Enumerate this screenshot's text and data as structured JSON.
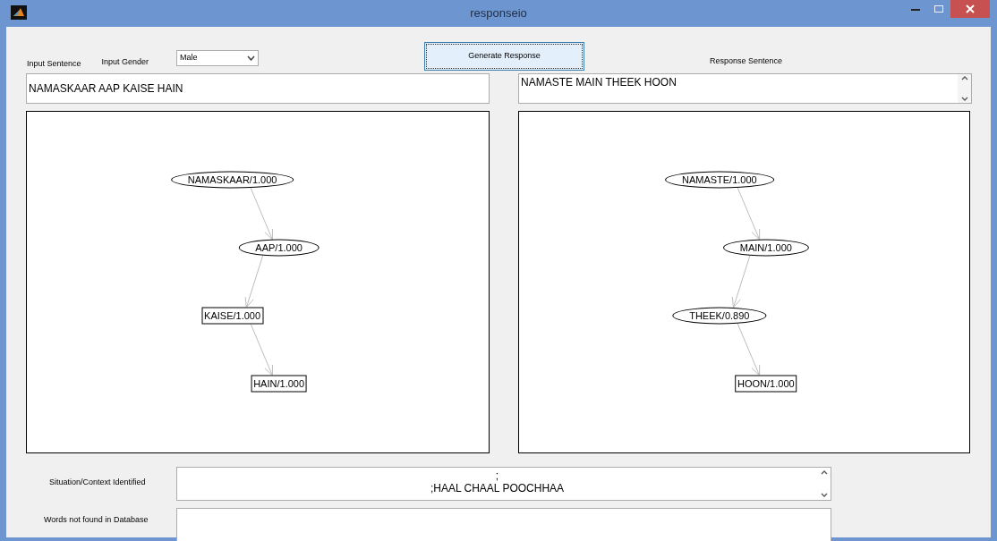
{
  "window": {
    "title": "responseio"
  },
  "input_sentence_label": "Input Sentence",
  "input_gender": {
    "label": "Input Gender",
    "value": "Male"
  },
  "generate_button": "Generate Response",
  "response_sentence_label": "Response Sentence",
  "input_sentence": "NAMASKAAR AAP KAISE HAIN",
  "response_sentence": "NAMASTE MAIN THEEK HOON",
  "input_graph": [
    {
      "label": "NAMASKAAR/1.000",
      "kind": "ellipse"
    },
    {
      "label": "AAP/1.000",
      "kind": "ellipse"
    },
    {
      "label": "KAISE/1.000",
      "kind": "box"
    },
    {
      "label": "HAIN/1.000",
      "kind": "box"
    }
  ],
  "response_graph": [
    {
      "label": "NAMASTE/1.000",
      "kind": "ellipse"
    },
    {
      "label": "MAIN/1.000",
      "kind": "ellipse"
    },
    {
      "label": "THEEK/0.890",
      "kind": "ellipse"
    },
    {
      "label": "HOON/1.000",
      "kind": "box"
    }
  ],
  "context": {
    "label": "Situation/Context Identified",
    "lines": [
      ";",
      ";HAAL CHAAL POOCHHAA"
    ]
  },
  "not_found": {
    "label": "Words not found in Database"
  }
}
